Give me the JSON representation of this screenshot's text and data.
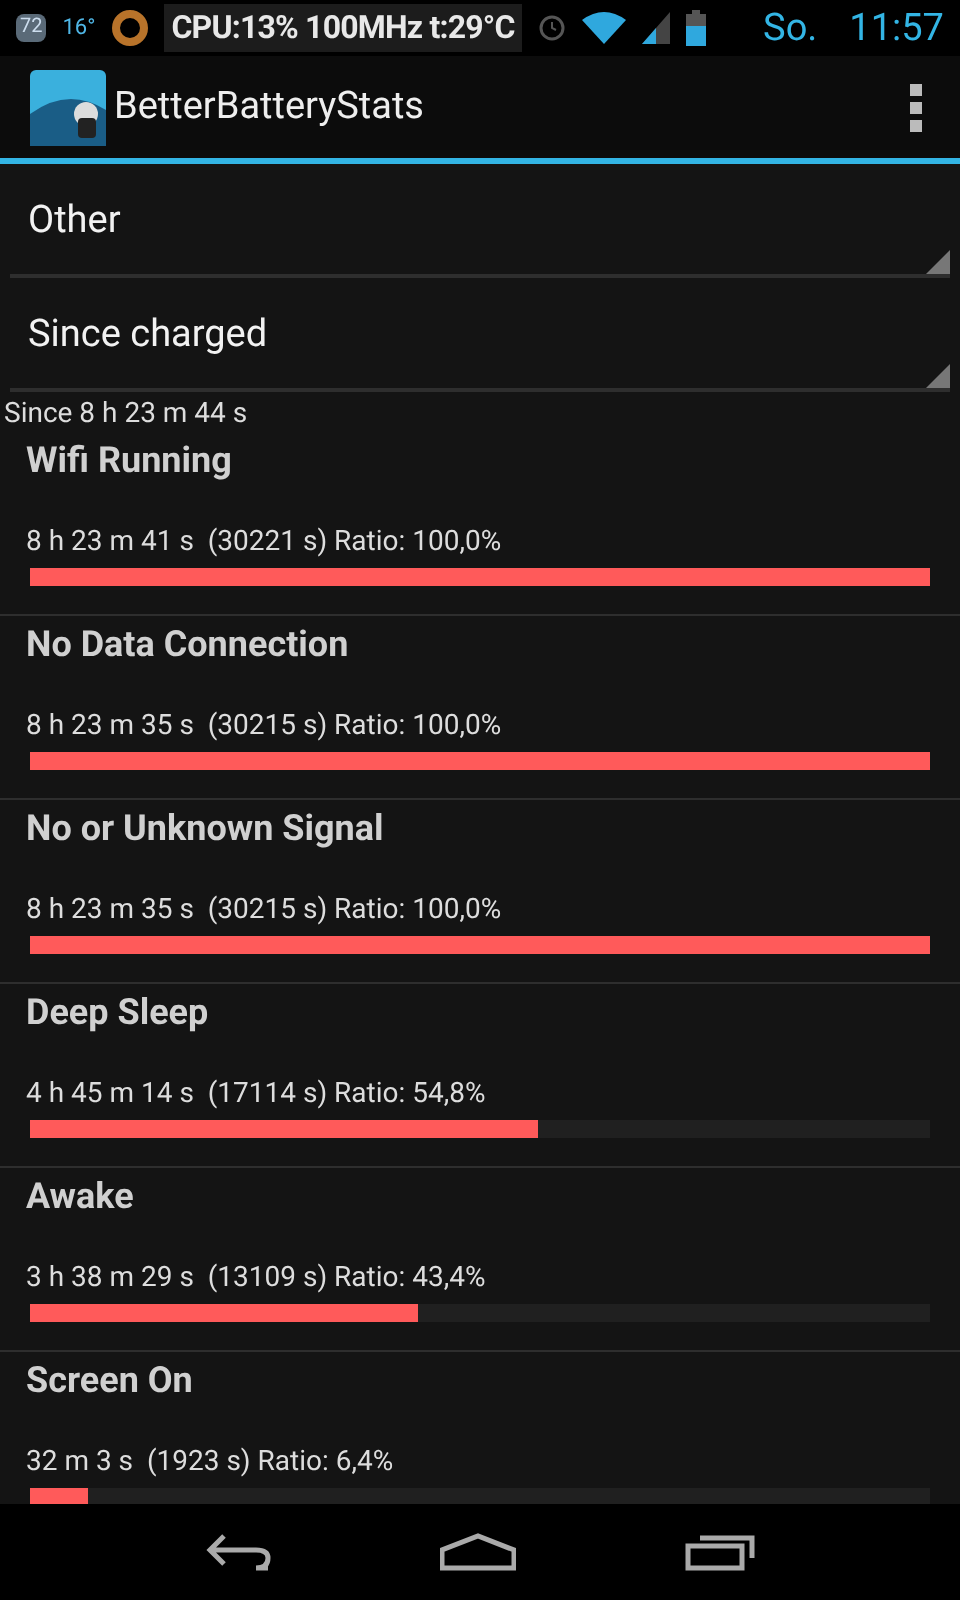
{
  "status_bar": {
    "battery_badge": "72",
    "temperature": "16°",
    "cpu": "CPU:13% 100MHz t:29°C",
    "day": "So.",
    "time": "11:57"
  },
  "action_bar": {
    "title": "BetterBatteryStats"
  },
  "spinners": [
    {
      "value": "Other"
    },
    {
      "value": "Since charged"
    }
  ],
  "since": "Since 8 h 23 m 44 s",
  "stats": [
    {
      "name": "Wifi Running",
      "detail": "8 h 23 m 41 s  (30221 s) Ratio: 100,0%",
      "level": 1.0
    },
    {
      "name": "No Data Connection",
      "detail": "8 h 23 m 35 s  (30215 s) Ratio: 100,0%",
      "level": 1.0
    },
    {
      "name": "No or Unknown Signal",
      "detail": "8 h 23 m 35 s  (30215 s) Ratio: 100,0%",
      "level": 1.0
    },
    {
      "name": "Deep Sleep",
      "detail": "4 h 45 m 14 s  (17114 s) Ratio: 54,8%",
      "level": 0.565
    },
    {
      "name": "Awake",
      "detail": "3 h 38 m 29 s  (13109 s) Ratio: 43,4%",
      "level": 0.432
    },
    {
      "name": "Screen On",
      "detail": "32 m 3 s  (1923 s) Ratio: 6,4%",
      "level": 0.064
    }
  ]
}
